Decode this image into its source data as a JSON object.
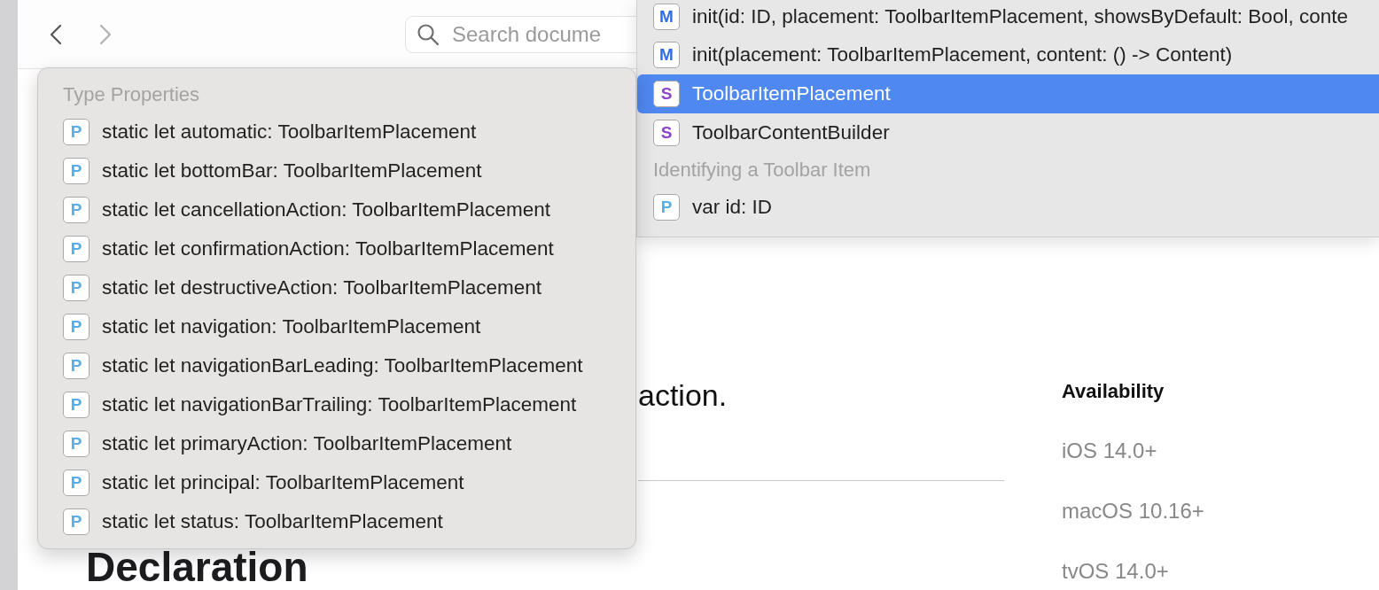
{
  "toolbar": {
    "back_enabled": true,
    "forward_enabled": false,
    "search": {
      "placeholder": "Search docume"
    }
  },
  "content": {
    "text_fragment": "action.",
    "heading": "Declaration",
    "availability": {
      "title": "Availability",
      "platforms": [
        "iOS 14.0+",
        "macOS 10.16+",
        "tvOS 14.0+"
      ]
    }
  },
  "symbol_menu": {
    "rows": [
      {
        "kind": "item",
        "badge": "M",
        "color": "#2f6fe0",
        "text": "init(id: ID, placement: ToolbarItemPlacement, showsByDefault: Bool, conte",
        "selected": false
      },
      {
        "kind": "item",
        "badge": "M",
        "color": "#2f6fe0",
        "text": "init(placement: ToolbarItemPlacement, content: () -> Content)",
        "selected": false
      },
      {
        "kind": "item",
        "badge": "S",
        "color": "#8c45c8",
        "text": "ToolbarItemPlacement",
        "selected": true
      },
      {
        "kind": "item",
        "badge": "S",
        "color": "#8c45c8",
        "text": "ToolbarContentBuilder",
        "selected": false
      },
      {
        "kind": "header",
        "text": "Identifying a Toolbar Item"
      },
      {
        "kind": "item",
        "badge": "P",
        "color": "#5aaee6",
        "text": "var id: ID",
        "selected": false
      }
    ]
  },
  "properties_menu": {
    "rows": [
      {
        "kind": "header",
        "text": "Type Properties"
      },
      {
        "kind": "item",
        "badge": "P",
        "color": "#5aaee6",
        "text": "static let automatic: ToolbarItemPlacement",
        "selected": false
      },
      {
        "kind": "item",
        "badge": "P",
        "color": "#5aaee6",
        "text": "static let bottomBar: ToolbarItemPlacement",
        "selected": false
      },
      {
        "kind": "item",
        "badge": "P",
        "color": "#5aaee6",
        "text": "static let cancellationAction: ToolbarItemPlacement",
        "selected": false
      },
      {
        "kind": "item",
        "badge": "P",
        "color": "#5aaee6",
        "text": "static let confirmationAction: ToolbarItemPlacement",
        "selected": false
      },
      {
        "kind": "item",
        "badge": "P",
        "color": "#5aaee6",
        "text": "static let destructiveAction: ToolbarItemPlacement",
        "selected": false
      },
      {
        "kind": "item",
        "badge": "P",
        "color": "#5aaee6",
        "text": "static let navigation: ToolbarItemPlacement",
        "selected": false
      },
      {
        "kind": "item",
        "badge": "P",
        "color": "#5aaee6",
        "text": "static let navigationBarLeading: ToolbarItemPlacement",
        "selected": false
      },
      {
        "kind": "item",
        "badge": "P",
        "color": "#5aaee6",
        "text": "static let navigationBarTrailing: ToolbarItemPlacement",
        "selected": false
      },
      {
        "kind": "item",
        "badge": "P",
        "color": "#5aaee6",
        "text": "static let primaryAction: ToolbarItemPlacement",
        "selected": false
      },
      {
        "kind": "item",
        "badge": "P",
        "color": "#5aaee6",
        "text": "static let principal: ToolbarItemPlacement",
        "selected": false
      },
      {
        "kind": "item",
        "badge": "P",
        "color": "#5aaee6",
        "text": "static let status: ToolbarItemPlacement",
        "selected": false
      }
    ]
  }
}
